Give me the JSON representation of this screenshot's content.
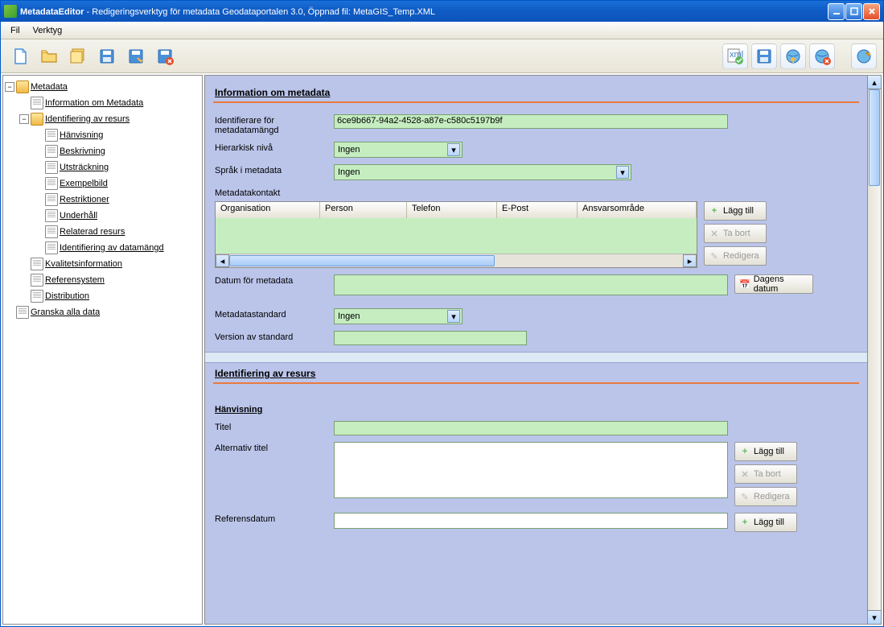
{
  "window": {
    "app_name": "MetadataEditor",
    "suffix": " - Redigeringsverktyg för metadata Geodataportalen 3.0,  Öppnad fil: MetaGIS_Temp.XML"
  },
  "menu": {
    "file": "Fil",
    "tools": "Verktyg"
  },
  "tree": {
    "root": "Metadata",
    "info": "Information om Metadata",
    "ident": "Identifiering av resurs",
    "hanvisning": "Hänvisning",
    "beskrivning": "Beskrivning",
    "utstrackning": "Utsträckning",
    "exempelbild": "Exempelbild",
    "restriktioner": "Restriktioner",
    "underhall": "Underhåll",
    "relaterad": "Relaterad resurs",
    "ident_data": "Identifiering av datamängd",
    "kvalitet": "Kvalitetsinformation",
    "refsys": "Referensystem",
    "distribution": "Distribution",
    "granska": "Granska alla data"
  },
  "section1": {
    "title": "Information om metadata",
    "fields": {
      "identifier_label": "Identifierare för metadatamängd",
      "identifier_value": "6ce9b667-94a2-4528-a87e-c580c5197b9f",
      "hierarki_label": "Hierarkisk nivå",
      "hierarki_value": "Ingen",
      "sprak_label": "Språk i metadata",
      "sprak_value": "Ingen",
      "kontakt_label": "Metadatakontakt",
      "datum_label": "Datum för metadata",
      "standard_label": "Metadatastandard",
      "standard_value": "Ingen",
      "version_label": "Version av standard"
    },
    "table_headers": {
      "org": "Organisation",
      "person": "Person",
      "telefon": "Telefon",
      "epost": "E-Post",
      "ansvar": "Ansvarsområde"
    }
  },
  "section2": {
    "title": "Identifiering av resurs",
    "sub": "Hänvisning",
    "titel_label": "Titel",
    "alt_titel_label": "Alternativ titel",
    "refdatum_label": "Referensdatum"
  },
  "buttons": {
    "add": "Lägg till",
    "remove": "Ta bort",
    "edit": "Redigera",
    "today": "Dagens datum"
  }
}
